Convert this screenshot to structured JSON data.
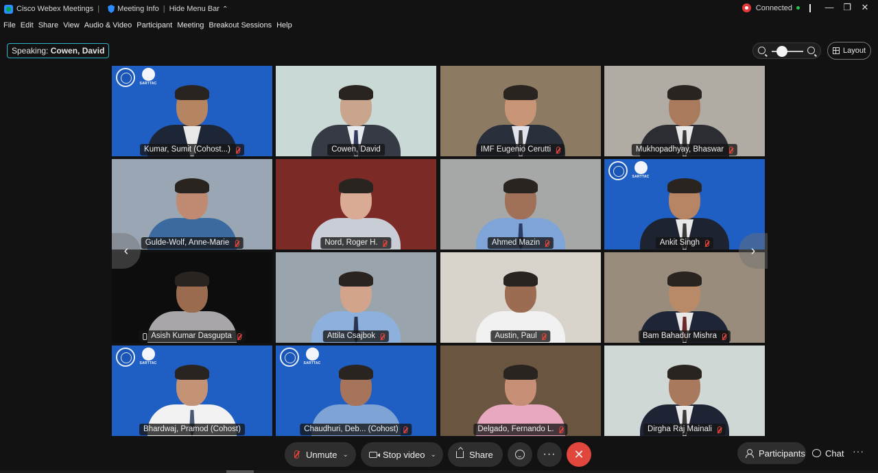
{
  "titlebar": {
    "app_name": "Cisco Webex Meetings",
    "separator": "|",
    "meeting_info": "Meeting Info",
    "hide_menu_bar": "Hide Menu Bar",
    "status": "Connected",
    "window_controls": [
      "—",
      "❐",
      "✕"
    ]
  },
  "menu": [
    "File",
    "Edit",
    "Share",
    "View",
    "Audio & Video",
    "Participant",
    "Meeting",
    "Breakout Sessions",
    "Help"
  ],
  "speaking": {
    "prefix": "Speaking:",
    "name": "Cowen, David"
  },
  "layout_label": "Layout",
  "participants": [
    {
      "name": "Kumar, Sumit  (Cohost...)",
      "muted": true,
      "bg": "#1f5fc4",
      "logo": true,
      "skin": "#b58562",
      "suit": "#1c2636",
      "shirt": "#e8e8e8",
      "tie": ""
    },
    {
      "name": "Cowen, David",
      "muted": false,
      "bg": "#c9d9d6",
      "logo": false,
      "skin": "#c9a58e",
      "suit": "#353a44",
      "shirt": "#e6e9ee",
      "tie": "#2f3b5c",
      "active": true
    },
    {
      "name": "IMF Eugenio Cerutti",
      "muted": true,
      "bg": "#8c7a62",
      "logo": false,
      "skin": "#c89576",
      "suit": "#2a2f3c",
      "shirt": "#e1e4ea",
      "tie": "#3d3d3d"
    },
    {
      "name": "Mukhopadhyay, Bhaswar",
      "muted": true,
      "bg": "#b0aba3",
      "logo": false,
      "skin": "#a97a5c",
      "suit": "#2c2c33",
      "shirt": "#e8e8e8",
      "tie": "#3a3a3a"
    },
    {
      "name": "Gulde-Wolf, Anne-Marie",
      "muted": true,
      "bg": "#9aa6b4",
      "logo": false,
      "skin": "#c08a72",
      "suit": "#3b6aa0",
      "shirt": "#3b6aa0",
      "tie": ""
    },
    {
      "name": "Nord, Roger H.",
      "muted": true,
      "bg": "#7b2a26",
      "logo": false,
      "skin": "#d9ab94",
      "suit": "#c9ced6",
      "shirt": "#c9ced6",
      "tie": ""
    },
    {
      "name": "Ahmed Mazin",
      "muted": true,
      "bg": "#a5a8a6",
      "logo": false,
      "skin": "#a07158",
      "suit": "#7fa4d8",
      "shirt": "#7fa4d8",
      "tie": "#2a3b66"
    },
    {
      "name": "Ankit Singh",
      "muted": true,
      "bg": "#1f5fc4",
      "logo": true,
      "skin": "#b78564",
      "suit": "#1d2330",
      "shirt": "#e8e8e8",
      "tie": "#3a3a3a"
    },
    {
      "name": "Asish Kumar Dasgupta",
      "muted": true,
      "phone": true,
      "bg": "#0d0d0d",
      "logo": false,
      "skin": "#9a6b4f",
      "suit": "#a8a6aa",
      "shirt": "#a8a6aa",
      "tie": ""
    },
    {
      "name": "Attila Csajbok",
      "muted": true,
      "bg": "#9aa4ad",
      "logo": false,
      "skin": "#d2a48c",
      "suit": "#8db1dc",
      "shirt": "#8db1dc",
      "tie": "#2a3552"
    },
    {
      "name": "Austin, Paul",
      "muted": true,
      "bg": "#d8d4cc",
      "logo": false,
      "skin": "#9c6c52",
      "suit": "#f1f1f1",
      "shirt": "#f1f1f1",
      "tie": ""
    },
    {
      "name": "Bam Bahadur Mishra",
      "muted": true,
      "bg": "#9a8c7c",
      "logo": false,
      "skin": "#b88a68",
      "suit": "#1d2536",
      "shirt": "#e8e8e8",
      "tie": "#6b2a2a"
    },
    {
      "name": "Bhardwaj, Pramod  (Cohost)",
      "muted": false,
      "bg": "#1f5fc4",
      "logo": true,
      "skin": "#c49274",
      "suit": "#f2f2f2",
      "shirt": "#f2f2f2",
      "tie": "#4a5a74"
    },
    {
      "name": "Chaudhuri, Deb...  (Cohost)",
      "muted": true,
      "bg": "#1f5fc4",
      "logo": true,
      "skin": "#a5745a",
      "suit": "#7ea4d6",
      "shirt": "#7ea4d6",
      "tie": ""
    },
    {
      "name": "Delgado, Fernando L.",
      "muted": true,
      "bg": "#6a5640",
      "logo": false,
      "skin": "#c79076",
      "suit": "#e8a9c0",
      "shirt": "#e8a9c0",
      "tie": ""
    },
    {
      "name": "Dirgha Raj Mainali",
      "muted": true,
      "bg": "#cfd8d4",
      "logo": false,
      "skin": "#a8795c",
      "suit": "#1e2433",
      "shirt": "#e8e8e8",
      "tie": "#3b3b3b"
    }
  ],
  "logo_text": "SARTTAC",
  "controls": {
    "unmute": "Unmute",
    "stop_video": "Stop video",
    "share": "Share",
    "more": "···",
    "leave": "✕",
    "participants": "Participants",
    "chat": "Chat",
    "more2": "···"
  },
  "nav": {
    "prev": "‹",
    "next": "›"
  }
}
